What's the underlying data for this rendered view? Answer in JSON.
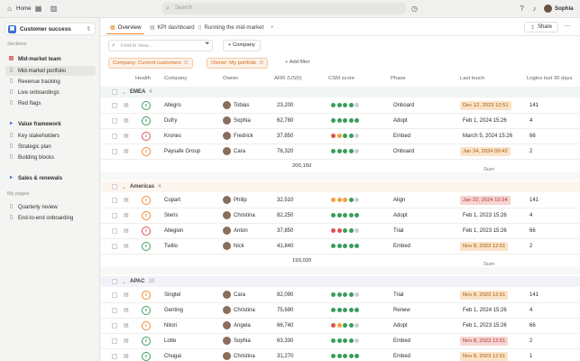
{
  "topbar": {
    "home": "Home",
    "search_placeholder": "Search",
    "user": "Sophia"
  },
  "sidebar": {
    "workspace": "Customer success",
    "sections_label": "Sections",
    "items": [
      {
        "label": "Mid-market team",
        "bold": true,
        "icon": "grid-icon",
        "color": "red"
      },
      {
        "label": "Mid-market portfolio",
        "active": true
      },
      {
        "label": "Revenue tracking"
      },
      {
        "label": "Live onboardings"
      },
      {
        "label": "Red flags"
      },
      {
        "label": "Value framework",
        "bold": true,
        "icon": "play-icon",
        "color": "blue"
      },
      {
        "label": "Key stakeholders"
      },
      {
        "label": "Strategic plan"
      },
      {
        "label": "Building blocks"
      },
      {
        "label": "Sales & renewals",
        "bold": true,
        "icon": "play-icon",
        "color": "blue"
      }
    ],
    "my_pages_label": "My pages",
    "pages": [
      {
        "label": "Quarterly review"
      },
      {
        "label": "End-to-end onboarding"
      }
    ]
  },
  "tabs": [
    {
      "label": "Overview",
      "active": true
    },
    {
      "label": "KPI dashboard"
    },
    {
      "label": "Running the mid-market"
    }
  ],
  "toolbar": {
    "share": "Share",
    "find_placeholder": "Find in view...",
    "company_btn": "+ Company",
    "add_filter": "Add filter"
  },
  "filters": [
    {
      "label": "Company: Current customers"
    },
    {
      "label": "Owner: My portfolio"
    }
  ],
  "columns": [
    "Health",
    "Company",
    "Owner",
    "ARR (USD)",
    "CSM score",
    "Phase",
    "Last touch",
    "Logins last 30 days"
  ],
  "groups": [
    {
      "name": "EMEA",
      "count": "4",
      "sum_label": "Sum",
      "sum": "200,150",
      "rows": [
        {
          "health": "9",
          "hc": "#3a9d5d",
          "company": "Allegro",
          "owner": "Tobias",
          "arr": "23,200",
          "dots": [
            "g",
            "g",
            "g",
            "g",
            "x"
          ],
          "phase": "Onboard",
          "touch": "Dec 12, 2023 12:51",
          "tstyle": "o",
          "logins": "141"
        },
        {
          "health": "9",
          "hc": "#3a9d5d",
          "company": "Dufry",
          "owner": "Sophia",
          "arr": "62,780",
          "dots": [
            "g",
            "g",
            "g",
            "g",
            "g"
          ],
          "phase": "Adopt",
          "touch": "Feb 1, 2024 15:26",
          "tstyle": "",
          "logins": "4"
        },
        {
          "health": "2",
          "hc": "#d9534f",
          "company": "Krones",
          "owner": "Fredrick",
          "arr": "37,850",
          "dots": [
            "r",
            "o",
            "g",
            "g",
            "x"
          ],
          "phase": "Embed",
          "touch": "March 5, 2024 15:26",
          "tstyle": "",
          "logins": "66"
        },
        {
          "health": "5",
          "hc": "#f08a2c",
          "company": "Paysafe Group",
          "owner": "Cara",
          "arr": "76,320",
          "dots": [
            "g",
            "g",
            "g",
            "g",
            "x"
          ],
          "phase": "Onboard",
          "touch": "Jan 24, 2024 09:42",
          "tstyle": "o",
          "logins": "2"
        }
      ]
    },
    {
      "name": "Americas",
      "count": "4",
      "sum_label": "Sum",
      "sum": "193,020",
      "rows": [
        {
          "health": "5",
          "hc": "#f08a2c",
          "company": "Copart",
          "owner": "Philip",
          "arr": "32,510",
          "dots": [
            "o",
            "o",
            "o",
            "g",
            "x"
          ],
          "phase": "Align",
          "touch": "Jan 22, 2024 10:24",
          "tstyle": "r",
          "logins": "141"
        },
        {
          "health": "5",
          "hc": "#f08a2c",
          "company": "Steris",
          "owner": "Christina",
          "arr": "82,250",
          "dots": [
            "g",
            "g",
            "g",
            "g",
            "g"
          ],
          "phase": "Adopt",
          "touch": "Feb 1, 2023 15:26",
          "tstyle": "",
          "logins": "4"
        },
        {
          "health": "2",
          "hc": "#d9534f",
          "company": "Allegion",
          "owner": "Anton",
          "arr": "37,850",
          "dots": [
            "r",
            "r",
            "g",
            "g",
            "x"
          ],
          "phase": "Trial",
          "touch": "Feb 1, 2023 15:26",
          "tstyle": "",
          "logins": "66"
        },
        {
          "health": "9",
          "hc": "#3a9d5d",
          "company": "Twilio",
          "owner": "Nick",
          "arr": "41,840",
          "dots": [
            "g",
            "g",
            "g",
            "g",
            "g"
          ],
          "phase": "Embed",
          "touch": "Nov 8, 2023 12:51",
          "tstyle": "o",
          "logins": "2"
        }
      ]
    },
    {
      "name": "APAC",
      "count": "10",
      "rows": [
        {
          "health": "5",
          "hc": "#f08a2c",
          "company": "Singtel",
          "owner": "Cara",
          "arr": "82,090",
          "dots": [
            "g",
            "g",
            "g",
            "g",
            "x"
          ],
          "phase": "Trial",
          "touch": "Nov 8, 2023 12:51",
          "tstyle": "o",
          "logins": "141"
        },
        {
          "health": "9",
          "hc": "#3a9d5d",
          "company": "Genting",
          "owner": "Christina",
          "arr": "75,690",
          "dots": [
            "g",
            "g",
            "g",
            "g",
            "g"
          ],
          "phase": "Renew",
          "touch": "Feb 1, 2024 15:26",
          "tstyle": "",
          "logins": "4"
        },
        {
          "health": "5",
          "hc": "#f08a2c",
          "company": "Nitori",
          "owner": "Angela",
          "arr": "66,740",
          "dots": [
            "r",
            "o",
            "g",
            "g",
            "x"
          ],
          "phase": "Adopt",
          "touch": "Feb 1, 2023 15:26",
          "tstyle": "",
          "logins": "66"
        },
        {
          "health": "9",
          "hc": "#3a9d5d",
          "company": "Lotte",
          "owner": "Sophia",
          "arr": "63,330",
          "dots": [
            "g",
            "g",
            "g",
            "g",
            "x"
          ],
          "phase": "Embed",
          "touch": "Nov 8, 2023 12:51",
          "tstyle": "r",
          "logins": "2"
        },
        {
          "health": "9",
          "hc": "#3a9d5d",
          "company": "Chugai",
          "owner": "Christina",
          "arr": "31,270",
          "dots": [
            "g",
            "g",
            "g",
            "g",
            "g"
          ],
          "phase": "Embed",
          "touch": "Nov 8, 2023 12:51",
          "tstyle": "o",
          "logins": "1"
        }
      ]
    }
  ],
  "colors": {
    "accent": "#f08a2c",
    "green": "#3a9d5d",
    "orange": "#f0a03c",
    "red": "#d9534f",
    "grey": "#d0d0cc"
  }
}
